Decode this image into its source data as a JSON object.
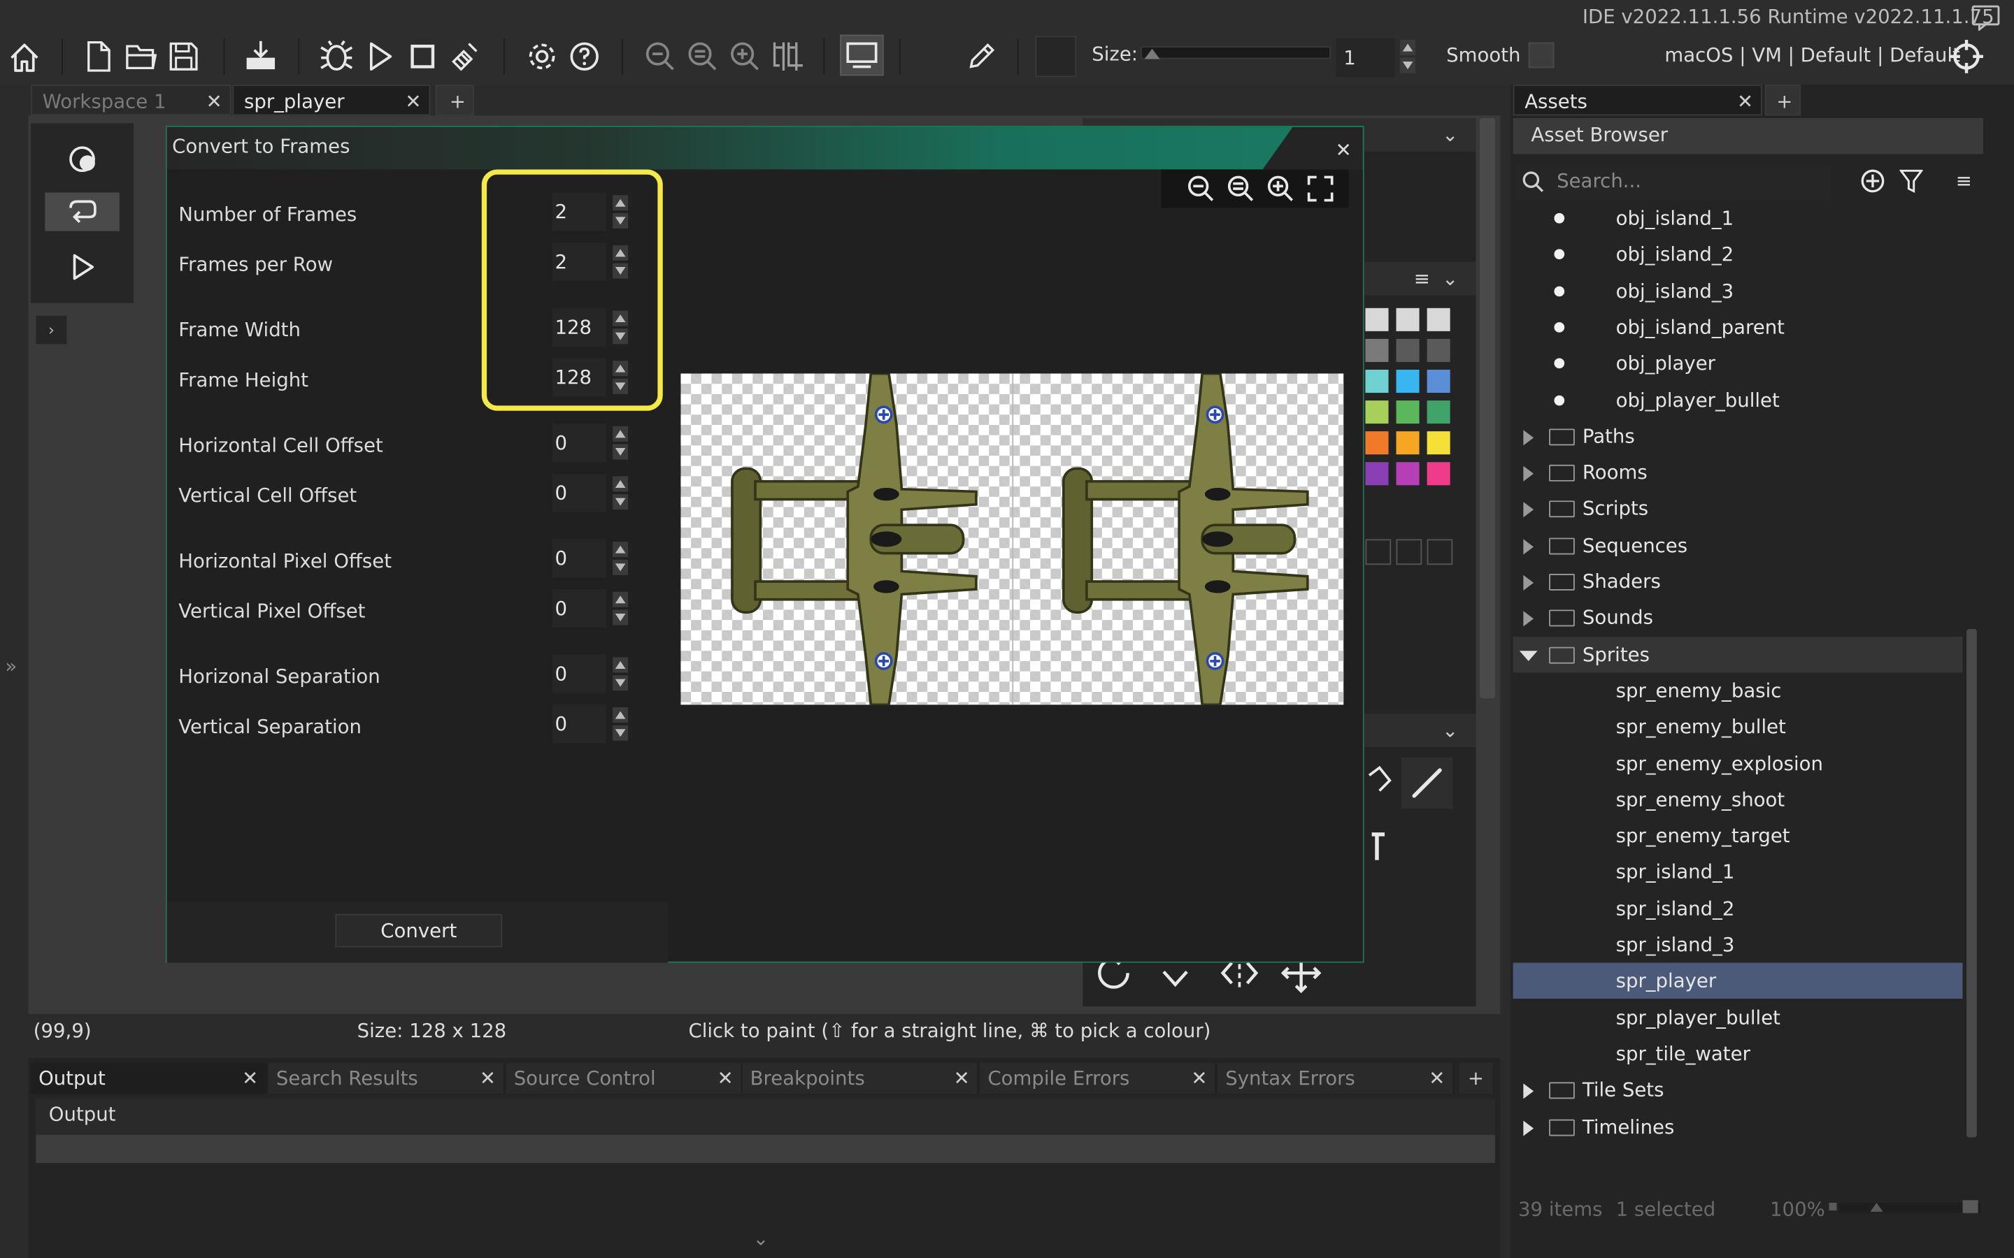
{
  "top_bar": {
    "version": "IDE v2022.11.1.56  Runtime v2022.11.1.75",
    "size_label": "Size:",
    "size_value": "1",
    "smooth_label": "Smooth",
    "target": "macOS | VM | Default | Default"
  },
  "tabs": {
    "workspace": "Workspace 1",
    "sprite": "spr_player",
    "add": "+"
  },
  "dialog": {
    "title": "Convert to Frames",
    "fields": [
      {
        "label": "Number of Frames",
        "value": "2"
      },
      {
        "label": "Frames per Row",
        "value": "2"
      },
      {
        "label": "Frame Width",
        "value": "128"
      },
      {
        "label": "Frame Height",
        "value": "128"
      },
      {
        "label": "Horizontal Cell Offset",
        "value": "0"
      },
      {
        "label": "Vertical Cell Offset",
        "value": "0"
      },
      {
        "label": "Horizontal Pixel Offset",
        "value": "0"
      },
      {
        "label": "Vertical Pixel Offset",
        "value": "0"
      },
      {
        "label": "Horizonal Separation",
        "value": "0"
      },
      {
        "label": "Vertical Separation",
        "value": "0"
      }
    ],
    "convert_button": "Convert",
    "highlight_color": "#f5e94a"
  },
  "status_bar": {
    "coords": "(99,9)",
    "size": "Size: 128 x 128",
    "hint": "Click to paint (⇧ for a straight line, ⌘ to pick a colour)"
  },
  "output_panel": {
    "tabs": [
      "Output",
      "Search Results",
      "Source Control",
      "Breakpoints",
      "Compile Errors",
      "Syntax Errors"
    ],
    "add": "+",
    "header": "Output"
  },
  "assets": {
    "tab": "Assets",
    "add": "+",
    "header": "Asset Browser",
    "search_placeholder": "Search...",
    "objects": [
      "obj_island_1",
      "obj_island_2",
      "obj_island_3",
      "obj_island_parent",
      "obj_player",
      "obj_player_bullet"
    ],
    "folders_before": [
      "Paths",
      "Rooms",
      "Scripts",
      "Sequences",
      "Shaders",
      "Sounds"
    ],
    "sprites_folder": "Sprites",
    "sprites": [
      "spr_enemy_basic",
      "spr_enemy_bullet",
      "spr_enemy_explosion",
      "spr_enemy_shoot",
      "spr_enemy_target",
      "spr_island_1",
      "spr_island_2",
      "spr_island_3",
      "spr_player",
      "spr_player_bullet",
      "spr_tile_water"
    ],
    "selected_sprite": "spr_player",
    "folders_after": [
      "Tile Sets",
      "Timelines"
    ],
    "footer_count": "39 items",
    "footer_selected": "1 selected",
    "footer_zoom": "100%"
  },
  "colors": {
    "accent_green": "#1a7a62",
    "selection": "#4a5a78",
    "palette": [
      "#d8d8d8",
      "#d8d8d8",
      "#d8d8d8",
      "#7a7a7a",
      "#5a5a5a",
      "#5a5a5a",
      "#6fd1d1",
      "#37b6f0",
      "#5a8fd8",
      "#a7cf5a",
      "#5ab85a",
      "#3fa36a",
      "#f07a2a",
      "#f5a623",
      "#f5e03a",
      "#8a3fb5",
      "#b53fb5",
      "#f03a8a"
    ]
  },
  "icons": [
    "home-icon",
    "new-file-icon",
    "open-folder-icon",
    "save-icon",
    "export-icon",
    "debug-icon",
    "run-icon",
    "stop-icon",
    "clean-icon",
    "settings-icon",
    "help-icon",
    "zoom-out-icon",
    "zoom-reset-icon",
    "zoom-in-icon",
    "layout-icon",
    "monitor-icon",
    "pencil-icon",
    "target-icon",
    "search-icon",
    "add-asset-icon",
    "filter-icon",
    "menu-icon"
  ]
}
